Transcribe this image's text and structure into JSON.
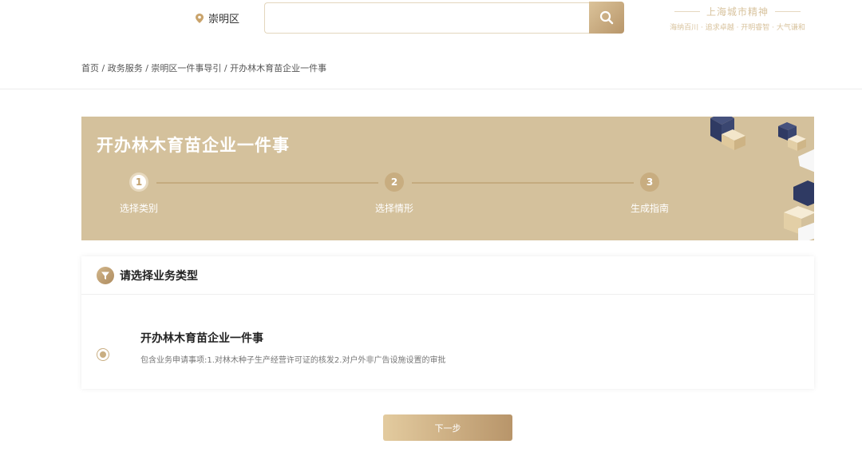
{
  "header": {
    "location": "崇明区",
    "search": {
      "value": "",
      "placeholder": ""
    },
    "slogan": {
      "title": "上海城市精神",
      "subtitle": "海纳百川 · 追求卓越 · 开明睿智 · 大气谦和"
    }
  },
  "breadcrumb": "首页 / 政务服务 / 崇明区一件事导引 / 开办林木育苗企业一件事",
  "banner": {
    "title": "开办林木育苗企业一件事",
    "steps": [
      {
        "number": "1",
        "label": "选择类别",
        "active": true
      },
      {
        "number": "2",
        "label": "选择情形",
        "active": false
      },
      {
        "number": "3",
        "label": "生成指南",
        "active": false
      }
    ]
  },
  "card": {
    "title": "请选择业务类型",
    "option": {
      "title": "开办林木育苗企业一件事",
      "description": "包含业务申请事项:1.对林木种子生产经营许可证的核发2.对户外非广告设施设置的审批",
      "selected": true
    }
  },
  "next_button": "下一步",
  "colors": {
    "accent": "#c9ae82",
    "banner_bg": "#d4c19c",
    "cube_dark": "#2f3a63"
  }
}
